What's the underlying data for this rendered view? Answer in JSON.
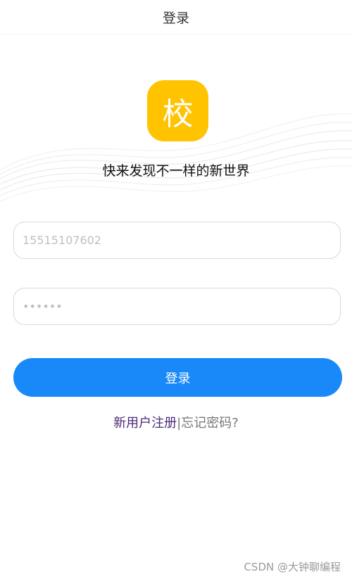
{
  "header": {
    "title": "登录"
  },
  "brand": {
    "logo_text": "校",
    "slogan": "快来发现不一样的新世界"
  },
  "form": {
    "phone": {
      "placeholder": "15515107602",
      "value": ""
    },
    "password": {
      "placeholder": "••••••",
      "value": ""
    },
    "login_label": "登录"
  },
  "links": {
    "register_label": "新用户注册",
    "separator": "|",
    "forgot_label": "忘记密码?"
  },
  "watermark": "CSDN @大钟聊编程",
  "colors": {
    "logo": "#ffc300",
    "primary_button": "#1989fa",
    "register_link": "#4a2a78"
  },
  "icons": {
    "hero": "abstract-wave-background"
  }
}
